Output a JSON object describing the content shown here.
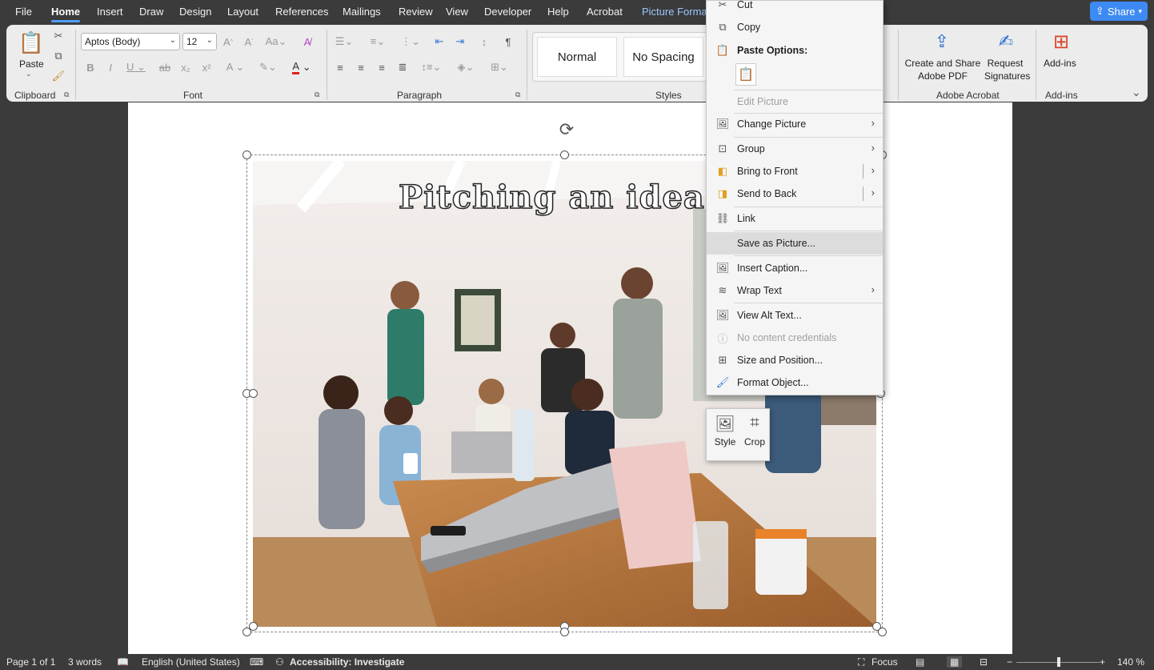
{
  "menu": {
    "tabs": [
      "File",
      "Home",
      "Insert",
      "Draw",
      "Design",
      "Layout",
      "References",
      "Mailings",
      "Review",
      "View",
      "Developer",
      "Help",
      "Acrobat",
      "Picture Forma"
    ],
    "active_tab": "Home",
    "share": "Share"
  },
  "ribbon": {
    "clipboard": {
      "paste": "Paste",
      "label": "Clipboard"
    },
    "font": {
      "family": "Aptos (Body)",
      "size": "12",
      "label": "Font"
    },
    "paragraph": {
      "label": "Paragraph"
    },
    "styles": {
      "normal": "Normal",
      "no_spacing": "No Spacing",
      "label": "Styles"
    },
    "adobe": {
      "create_share_1": "Create and Share",
      "create_share_2": "Adobe PDF",
      "request_1": "Request",
      "request_2": "Signatures",
      "label": "Adobe Acrobat"
    },
    "addins": {
      "button": "Add-ins",
      "label": "Add-ins"
    }
  },
  "document": {
    "image_title": "Pitching an idea"
  },
  "context_menu": {
    "cut": "Cut",
    "copy": "Copy",
    "paste_options": "Paste Options:",
    "edit_picture": "Edit Picture",
    "change_picture": "Change Picture",
    "group": "Group",
    "bring_to_front": "Bring to Front",
    "send_to_back": "Send to Back",
    "link": "Link",
    "save_as_picture": "Save as Picture...",
    "insert_caption": "Insert Caption...",
    "wrap_text": "Wrap Text",
    "view_alt_text": "View Alt Text...",
    "no_content_credentials": "No content credentials",
    "size_and_position": "Size and Position...",
    "format_object": "Format Object..."
  },
  "mini_toolbar": {
    "style": "Style",
    "crop": "Crop"
  },
  "status": {
    "page": "Page 1 of 1",
    "words": "3 words",
    "language": "English (United States)",
    "accessibility": "Accessibility: Investigate",
    "focus": "Focus",
    "zoom": "140 %"
  }
}
